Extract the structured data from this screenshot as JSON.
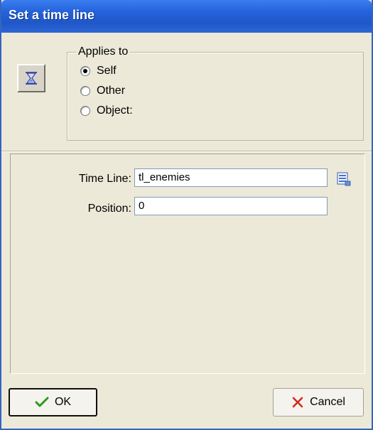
{
  "window": {
    "title": "Set a time line"
  },
  "action_icon": "hourglass-icon",
  "applies_to": {
    "legend": "Applies to",
    "options": [
      {
        "label": "Self",
        "checked": true
      },
      {
        "label": "Other",
        "checked": false
      },
      {
        "label": "Object:",
        "checked": false
      }
    ]
  },
  "fields": {
    "time_line": {
      "label": "Time Line:",
      "value": "tl_enemies",
      "browse_icon": "browse-list-icon"
    },
    "position": {
      "label": "Position:",
      "value": "0"
    }
  },
  "buttons": {
    "ok": {
      "label": "OK",
      "icon": "checkmark-icon",
      "color": "#2c9a1a"
    },
    "cancel": {
      "label": "Cancel",
      "icon": "x-mark-icon",
      "color": "#d42a1c"
    }
  }
}
